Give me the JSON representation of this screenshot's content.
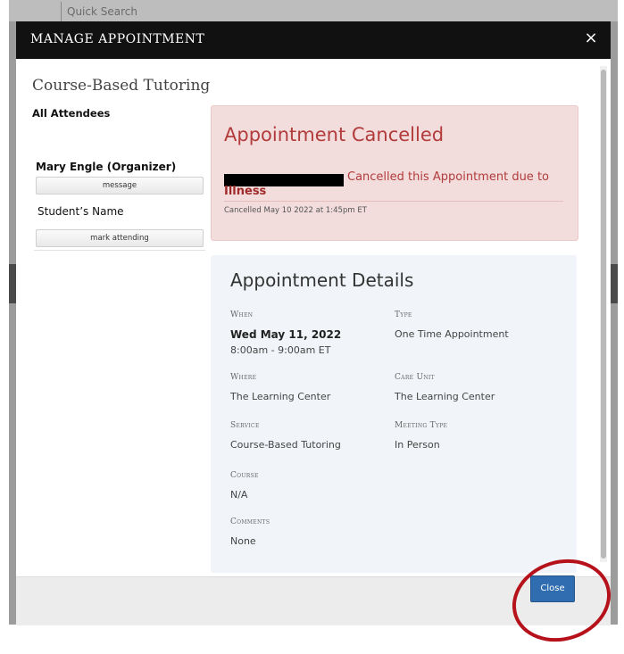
{
  "background": {
    "search_label": "Quick Search"
  },
  "modal": {
    "title": "MANAGE APPOINTMENT",
    "close_glyph": "×",
    "section_title": "Course-Based Tutoring",
    "attendees": {
      "heading": "All Attendees",
      "organizer_name": "Mary Engle (Organizer)",
      "message_button": "message",
      "student_name": "Student’s Name",
      "mark_attending_button": "mark attending"
    },
    "cancellation": {
      "title": "Appointment Cancelled",
      "text": "Cancelled this Appointment due to",
      "reason": "Illness",
      "timestamp": "Cancelled May 10 2022 at 1:45pm ET"
    },
    "details": {
      "title": "Appointment Details",
      "when_label": "When",
      "when_date": "Wed May 11, 2022",
      "when_time": "8:00am - 9:00am ET",
      "type_label": "Type",
      "type_value": "One Time Appointment",
      "where_label": "Where",
      "where_value": "The Learning Center",
      "care_unit_label": "Care Unit",
      "care_unit_value": "The Learning Center",
      "service_label": "Service",
      "service_value": "Course-Based Tutoring",
      "meeting_type_label": "Meeting Type",
      "meeting_type_value": "In Person",
      "course_label": "Course",
      "course_value": "N/A",
      "comments_label": "Comments",
      "comments_value": "None"
    },
    "footer": {
      "close_button": "Close"
    }
  },
  "colors": {
    "header_bg": "#111111",
    "cancel_bg": "#f2dcdc",
    "cancel_text": "#b23b3b",
    "details_bg": "#f1f5f9",
    "close_button_bg": "#2f6db0",
    "annotation": "#b5121b"
  }
}
